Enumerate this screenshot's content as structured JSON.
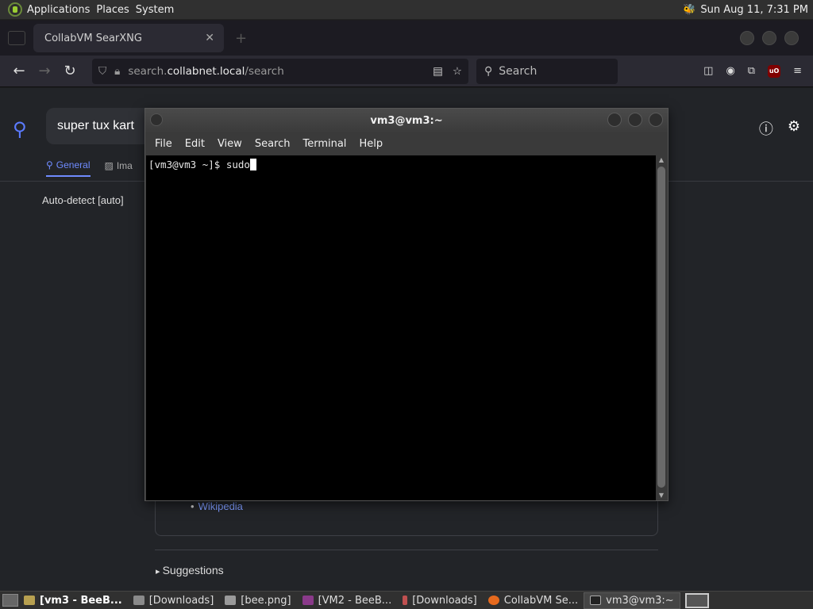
{
  "top_panel": {
    "menus": [
      "Applications",
      "Places",
      "System"
    ],
    "datetime": "Sun Aug 11,  7:31 PM"
  },
  "firefox": {
    "tab_title": "CollabVM SearXNG",
    "url_prefix": "search.",
    "url_host": "collabnet.local",
    "url_path": "/search",
    "search_placeholder": "Search",
    "ublock_label": "uO"
  },
  "searxng": {
    "query": "super tux kart",
    "categories": [
      {
        "label": "General",
        "icon": "search-icon",
        "active": true
      },
      {
        "label": "Ima",
        "icon": "image-icon",
        "active": false
      }
    ],
    "language": "Auto-detect [auto]",
    "wiki_link": "Wikipedia",
    "suggestions_label": "Suggestions"
  },
  "terminal": {
    "title": "vm3@vm3:~",
    "menu": [
      "File",
      "Edit",
      "View",
      "Search",
      "Terminal",
      "Help"
    ],
    "prompt": "[vm3@vm3 ~]$ ",
    "input": "sudo"
  },
  "taskbar": {
    "items": [
      {
        "label": "[vm3 - BeeB...",
        "icon": "bee-icon",
        "bold": true,
        "active": false,
        "color": "#b8a050"
      },
      {
        "label": "[Downloads]",
        "icon": "folder-icon",
        "bold": false,
        "active": false,
        "color": "#8a8a8a"
      },
      {
        "label": "[bee.png]",
        "icon": "image-icon",
        "bold": false,
        "active": false,
        "color": "#9a9a9a"
      },
      {
        "label": "[VM2 - BeeB...",
        "icon": "app-icon",
        "bold": false,
        "active": false,
        "color": "#8a3a8a"
      },
      {
        "label": "[Downloads]",
        "icon": "torch-icon",
        "bold": false,
        "active": false,
        "color": "#c05050"
      },
      {
        "label": "CollabVM Se...",
        "icon": "firefox-icon",
        "bold": false,
        "active": false,
        "color": "#e66a1e"
      },
      {
        "label": "vm3@vm3:~",
        "icon": "terminal-icon",
        "bold": false,
        "active": true,
        "color": "#222222"
      }
    ]
  }
}
